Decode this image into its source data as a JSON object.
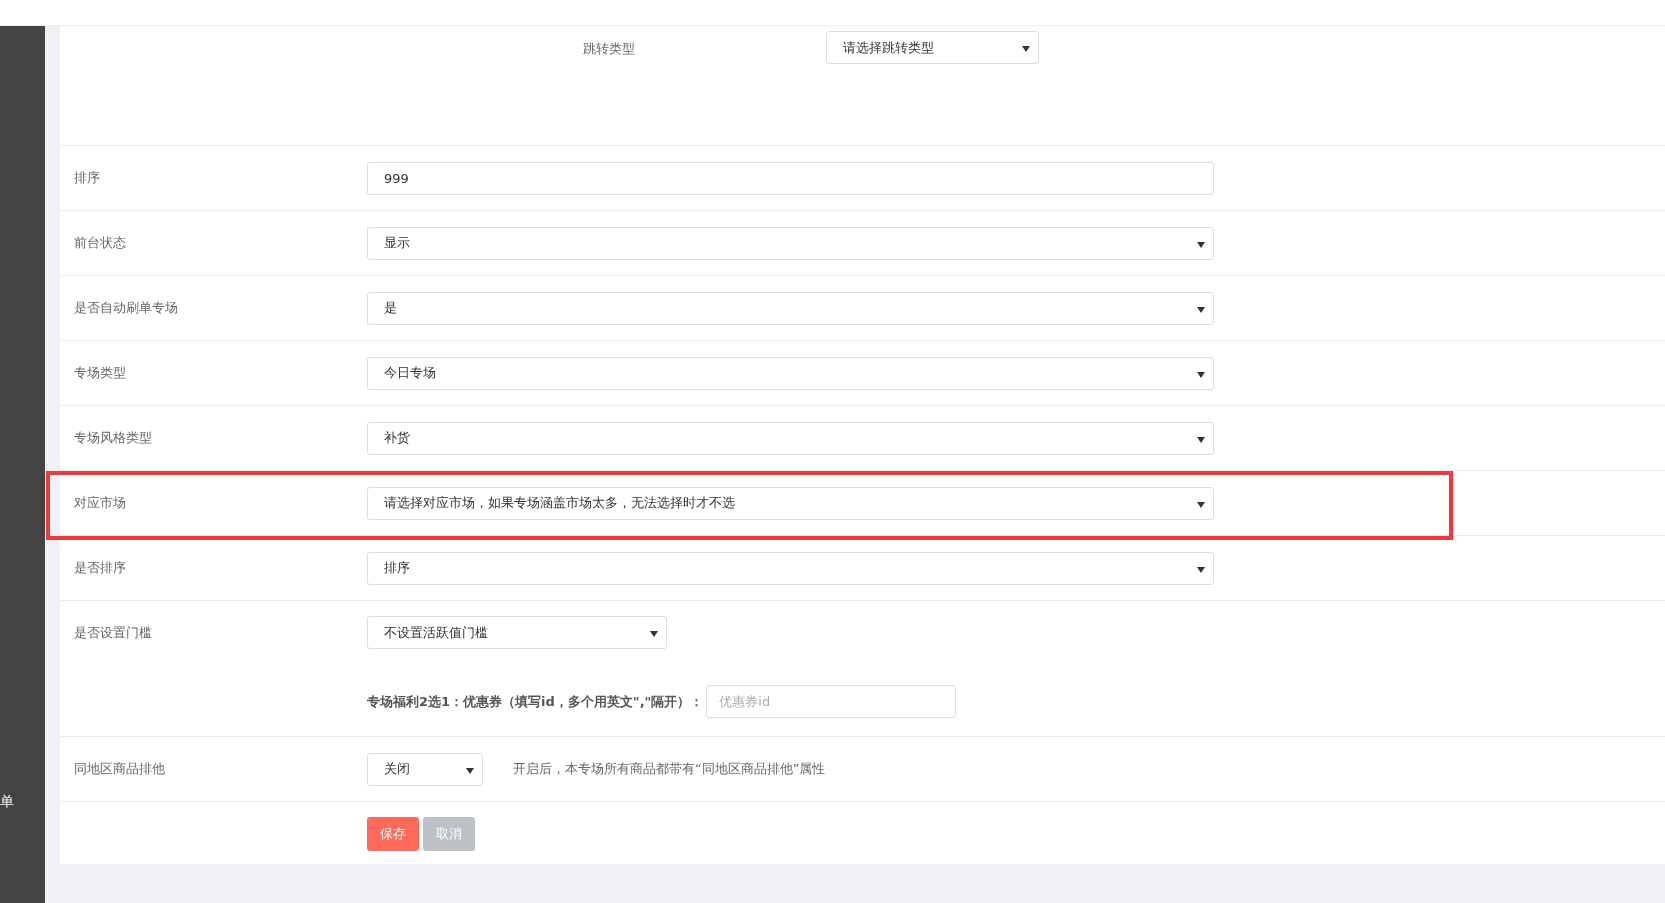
{
  "sidebar": {
    "item_fragment": "单"
  },
  "jump_type": {
    "label": "跳转类型",
    "value": "请选择跳转类型"
  },
  "fields": [
    {
      "label": "排序",
      "kind": "input",
      "value": "999",
      "highlighted": false
    },
    {
      "label": "前台状态",
      "kind": "select",
      "value": "显示",
      "highlighted": false
    },
    {
      "label": "是否自动刷单专场",
      "kind": "select",
      "value": "是",
      "highlighted": false
    },
    {
      "label": "专场类型",
      "kind": "select",
      "value": "今日专场",
      "highlighted": false
    },
    {
      "label": "专场风格类型",
      "kind": "select",
      "value": "补货",
      "highlighted": false
    },
    {
      "label": "对应市场",
      "kind": "select",
      "value": "请选择对应市场，如果专场涵盖市场太多，无法选择时才不选",
      "highlighted": true
    },
    {
      "label": "是否排序",
      "kind": "select",
      "value": "排序",
      "highlighted": false
    },
    {
      "label": "是否设置门槛",
      "kind": "select-medium",
      "value": "不设置活跃值门槛",
      "highlighted": false,
      "extra": {
        "label": "专场福利2选1：优惠券（填写id，多个用英文\",\"隔开）：",
        "placeholder": "优惠券id"
      }
    },
    {
      "label": "同地区商品排他",
      "kind": "select-small",
      "value": "关闭",
      "highlighted": false,
      "note": "开启后，本专场所有商品都带有“同地区商品排他”属性"
    }
  ],
  "buttons": [
    {
      "label": "保存",
      "kind": "primary"
    },
    {
      "label": "取消",
      "kind": "secondary"
    }
  ]
}
